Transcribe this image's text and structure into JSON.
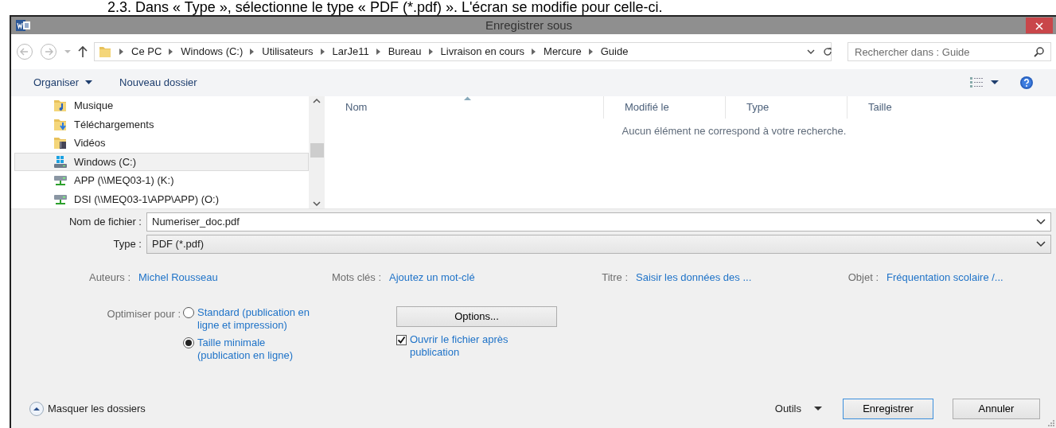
{
  "caption": "2.3.  Dans « Type », sélectionne le type « PDF (*.pdf) ». L'écran se modifie pour celle-ci.",
  "window": {
    "title": "Enregistrer sous"
  },
  "address": {
    "path": [
      "Ce PC",
      "Windows (C:)",
      "Utilisateurs",
      "LarJe11",
      "Bureau",
      "Livraison en cours",
      "Mercure",
      "Guide"
    ]
  },
  "search": {
    "placeholder": "Rechercher dans : Guide"
  },
  "toolbar": {
    "organize": "Organiser",
    "new_folder": "Nouveau dossier"
  },
  "sidebar": {
    "items": [
      {
        "label": "Musique",
        "kind": "music",
        "selected": false
      },
      {
        "label": "Téléchargements",
        "kind": "download",
        "selected": false
      },
      {
        "label": "Vidéos",
        "kind": "video",
        "selected": false
      },
      {
        "label": "Windows (C:)",
        "kind": "drive",
        "selected": true
      },
      {
        "label": "APP (\\\\MEQ03-1) (K:)",
        "kind": "network",
        "selected": false
      },
      {
        "label": "DSI (\\\\MEQ03-1\\APP\\APP) (O:)",
        "kind": "network",
        "selected": false
      }
    ]
  },
  "file_list": {
    "columns": [
      {
        "label": "Nom",
        "sorted": true
      },
      {
        "label": "Modifié le",
        "sorted": false
      },
      {
        "label": "Type",
        "sorted": false
      },
      {
        "label": "Taille",
        "sorted": false
      }
    ],
    "empty_message": "Aucun élément ne correspond à votre recherche."
  },
  "filename": {
    "label": "Nom de fichier :",
    "value": "Numeriser_doc.pdf"
  },
  "file_type": {
    "label": "Type :",
    "value": "PDF (*.pdf)"
  },
  "metadata": [
    {
      "label": "Auteurs :",
      "value": "Michel Rousseau"
    },
    {
      "label": "Mots clés :",
      "value": "Ajoutez un mot-clé"
    },
    {
      "label": "Titre :",
      "value": "Saisir les données des ..."
    },
    {
      "label": "Objet :",
      "value": "Fréquentation scolaire /..."
    }
  ],
  "optimize": {
    "label": "Optimiser pour :",
    "options": [
      {
        "label": "Standard (publication en ligne et impression)",
        "selected": false
      },
      {
        "label": "Taille minimale (publication en ligne)",
        "selected": true
      }
    ]
  },
  "options_button": "Options...",
  "open_after": {
    "label": "Ouvrir le fichier après publication",
    "checked": true
  },
  "hide_folders": "Masquer les dossiers",
  "tools": "Outils",
  "buttons": [
    {
      "label": "Enregistrer",
      "default": true
    },
    {
      "label": "Annuler",
      "default": false
    }
  ]
}
